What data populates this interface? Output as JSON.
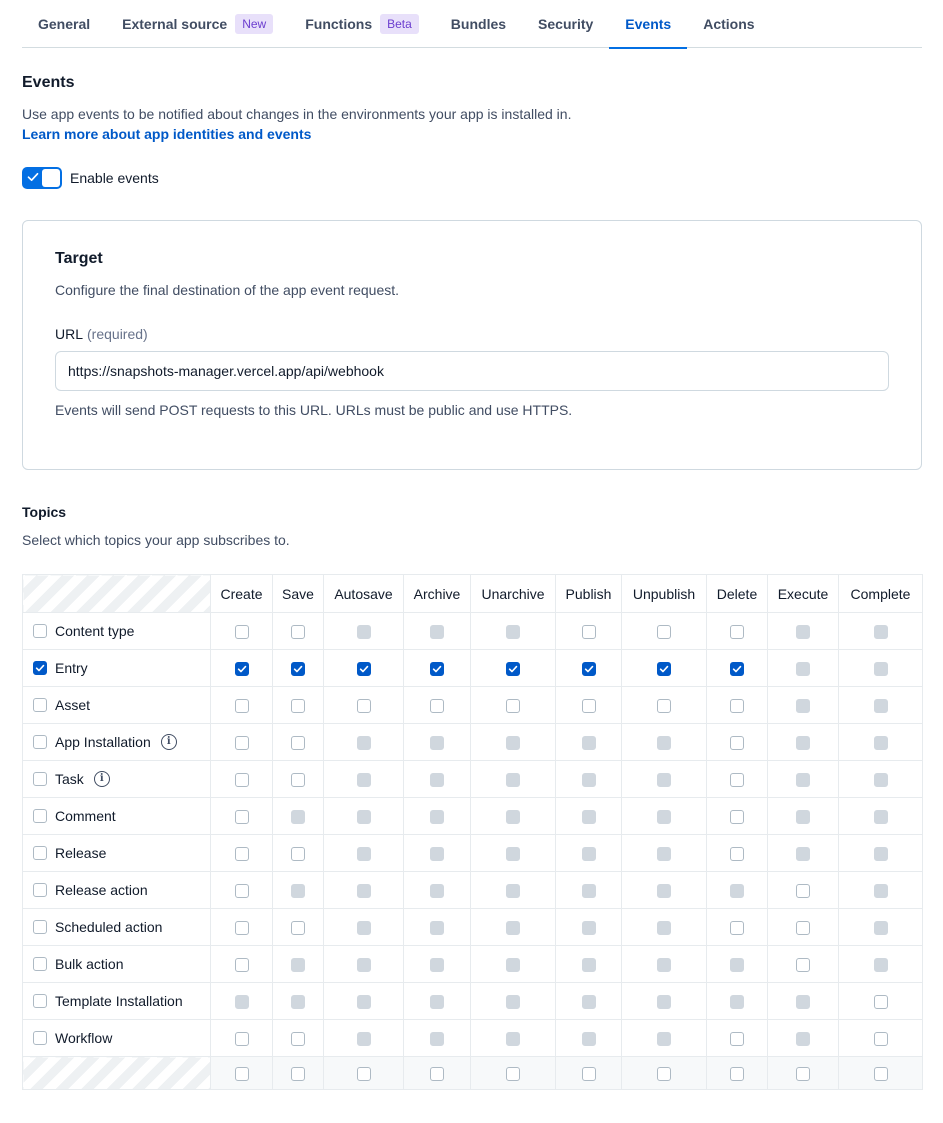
{
  "tabs": [
    {
      "label": "General",
      "badge": null,
      "active": false
    },
    {
      "label": "External source",
      "badge": "New",
      "active": false
    },
    {
      "label": "Functions",
      "badge": "Beta",
      "active": false
    },
    {
      "label": "Bundles",
      "badge": null,
      "active": false
    },
    {
      "label": "Security",
      "badge": null,
      "active": false
    },
    {
      "label": "Events",
      "badge": null,
      "active": true
    },
    {
      "label": "Actions",
      "badge": null,
      "active": false
    }
  ],
  "events": {
    "title": "Events",
    "description": "Use app events to be notified about changes in the environments your app is installed in.",
    "learn_more": "Learn more about app identities and events",
    "toggle_label": "Enable events",
    "toggle_on": true
  },
  "target": {
    "title": "Target",
    "description": "Configure the final destination of the app event request.",
    "url_label": "URL",
    "url_required": "(required)",
    "url_value": "https://snapshots-manager.vercel.app/api/webhook",
    "url_help": "Events will send POST requests to this URL. URLs must be public and use HTTPS."
  },
  "topics": {
    "title": "Topics",
    "description": "Select which topics your app subscribes to.",
    "columns": [
      "Create",
      "Save",
      "Autosave",
      "Archive",
      "Unarchive",
      "Publish",
      "Unpublish",
      "Delete",
      "Execute",
      "Complete"
    ],
    "rows": [
      {
        "label": "Content type",
        "checked": false,
        "info": false,
        "cells": [
          "off",
          "off",
          "dis",
          "dis",
          "dis",
          "off",
          "off",
          "off",
          "dis",
          "dis"
        ]
      },
      {
        "label": "Entry",
        "checked": true,
        "info": false,
        "cells": [
          "on",
          "on",
          "on",
          "on",
          "on",
          "on",
          "on",
          "on",
          "dis",
          "dis"
        ]
      },
      {
        "label": "Asset",
        "checked": false,
        "info": false,
        "cells": [
          "off",
          "off",
          "off",
          "off",
          "off",
          "off",
          "off",
          "off",
          "dis",
          "dis"
        ]
      },
      {
        "label": "App Installation",
        "checked": false,
        "info": true,
        "cells": [
          "off",
          "off",
          "dis",
          "dis",
          "dis",
          "dis",
          "dis",
          "off",
          "dis",
          "dis"
        ]
      },
      {
        "label": "Task",
        "checked": false,
        "info": true,
        "cells": [
          "off",
          "off",
          "dis",
          "dis",
          "dis",
          "dis",
          "dis",
          "off",
          "dis",
          "dis"
        ]
      },
      {
        "label": "Comment",
        "checked": false,
        "info": false,
        "cells": [
          "off",
          "dis",
          "dis",
          "dis",
          "dis",
          "dis",
          "dis",
          "off",
          "dis",
          "dis"
        ]
      },
      {
        "label": "Release",
        "checked": false,
        "info": false,
        "cells": [
          "off",
          "off",
          "dis",
          "dis",
          "dis",
          "dis",
          "dis",
          "off",
          "dis",
          "dis"
        ]
      },
      {
        "label": "Release action",
        "checked": false,
        "info": false,
        "cells": [
          "off",
          "dis",
          "dis",
          "dis",
          "dis",
          "dis",
          "dis",
          "dis",
          "off",
          "dis"
        ]
      },
      {
        "label": "Scheduled action",
        "checked": false,
        "info": false,
        "cells": [
          "off",
          "off",
          "dis",
          "dis",
          "dis",
          "dis",
          "dis",
          "off",
          "off",
          "dis"
        ]
      },
      {
        "label": "Bulk action",
        "checked": false,
        "info": false,
        "cells": [
          "off",
          "dis",
          "dis",
          "dis",
          "dis",
          "dis",
          "dis",
          "dis",
          "off",
          "dis"
        ]
      },
      {
        "label": "Template Installation",
        "checked": false,
        "info": false,
        "cells": [
          "dis",
          "dis",
          "dis",
          "dis",
          "dis",
          "dis",
          "dis",
          "dis",
          "dis",
          "off"
        ]
      },
      {
        "label": "Workflow",
        "checked": false,
        "info": false,
        "cells": [
          "off",
          "off",
          "dis",
          "dis",
          "dis",
          "dis",
          "dis",
          "off",
          "dis",
          "off"
        ]
      }
    ],
    "footer_cells": [
      "off",
      "off",
      "off",
      "off",
      "off",
      "off",
      "off",
      "off",
      "off",
      "off"
    ]
  }
}
